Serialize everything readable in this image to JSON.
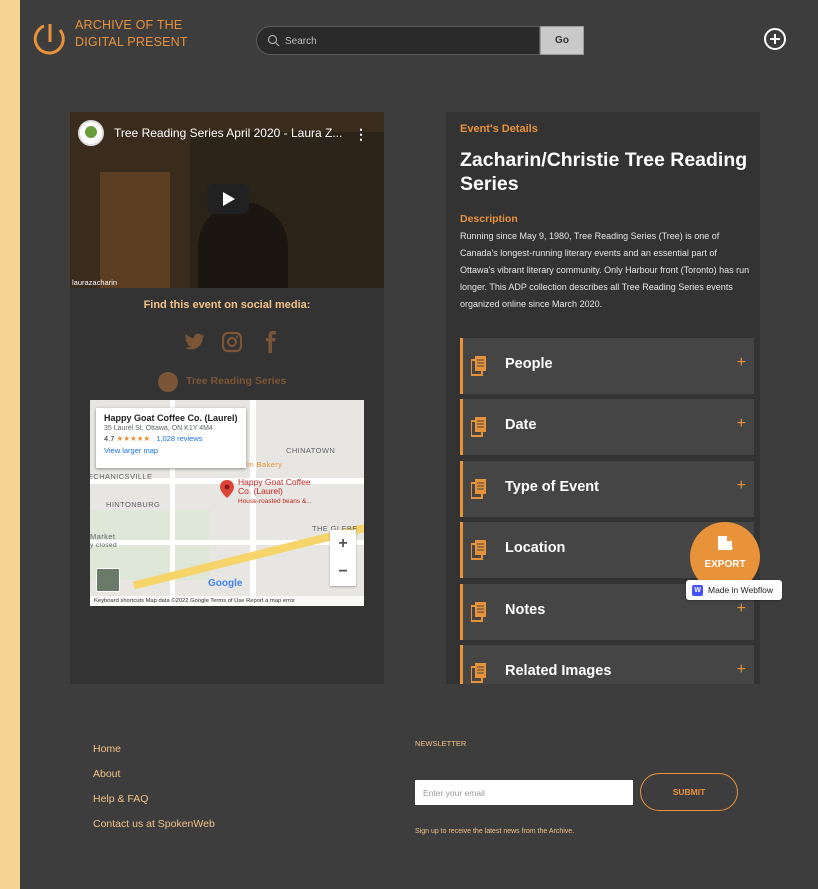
{
  "header": {
    "logo_line1": "ARCHIVE OF THE",
    "logo_line2": "DIGITAL PRESENT",
    "search_placeholder": "Search",
    "go_label": "Go"
  },
  "video": {
    "title": "Tree Reading Series April 2020 - Laura Z...",
    "username": "laurazacharin",
    "menu": "⋮"
  },
  "social": {
    "heading": "Find this event on social media:",
    "icons": [
      "twitter-icon",
      "instagram-icon",
      "facebook-icon"
    ],
    "org_name": "Tree Reading Series"
  },
  "map": {
    "place_name": "Happy Goat Coffee Co. (Laurel)",
    "address": "35 Laurel St, Ottawa, ON K1Y 4M4",
    "rating": "4.7",
    "stars": "★★★★★",
    "reviews": "1,028 reviews",
    "view_link": "View larger map",
    "pin_label_line1": "Happy Goat Coffee",
    "pin_label_line2": "Co. (Laurel)",
    "pin_sub": "House-roasted beans &...",
    "labels": {
      "chinatown": "CHINATOWN",
      "mechanicsville": "ECHANICSVILLE",
      "hintonburg": "HINTONBURG",
      "glebe": "THE GLEBE",
      "bakery": "s-In Bakery",
      "market": "Market",
      "closed": "y closed"
    },
    "google": "Google",
    "footer": "Keyboard shortcuts   Map data ©2022 Google   Terms of Use   Report a map error"
  },
  "details": {
    "section_label": "Event's Details",
    "title": "Zacharin/Christie Tree Reading Series",
    "description_label": "Description",
    "description": "Running since May 9, 1980, Tree Reading Series (Tree) is one of Canada's longest-running literary events and an essential part of Ottawa's vibrant literary community. Only Harbour front (Toronto) has run longer. This ADP collection describes all Tree Reading Series events organized online since March 2020.",
    "accordion": [
      {
        "label": "People"
      },
      {
        "label": "Date"
      },
      {
        "label": "Type of Event"
      },
      {
        "label": "Location"
      },
      {
        "label": "Notes"
      },
      {
        "label": "Related Images"
      }
    ]
  },
  "export": {
    "label": "EXPORT"
  },
  "webflow": {
    "label": "Made in Webflow"
  },
  "footer": {
    "links": [
      "Home",
      "About",
      "Help & FAQ",
      "Contact us at SpokenWeb"
    ],
    "newsletter_heading": "NEWSLETTER",
    "email_placeholder": "Enter your email",
    "submit_label": "SUBMIT",
    "note": "Sign up to receive the latest news from the Archive."
  },
  "colors": {
    "accent": "#e8923a",
    "background": "#3d3d3d",
    "panel": "#333333",
    "outer": "#f4d490"
  }
}
